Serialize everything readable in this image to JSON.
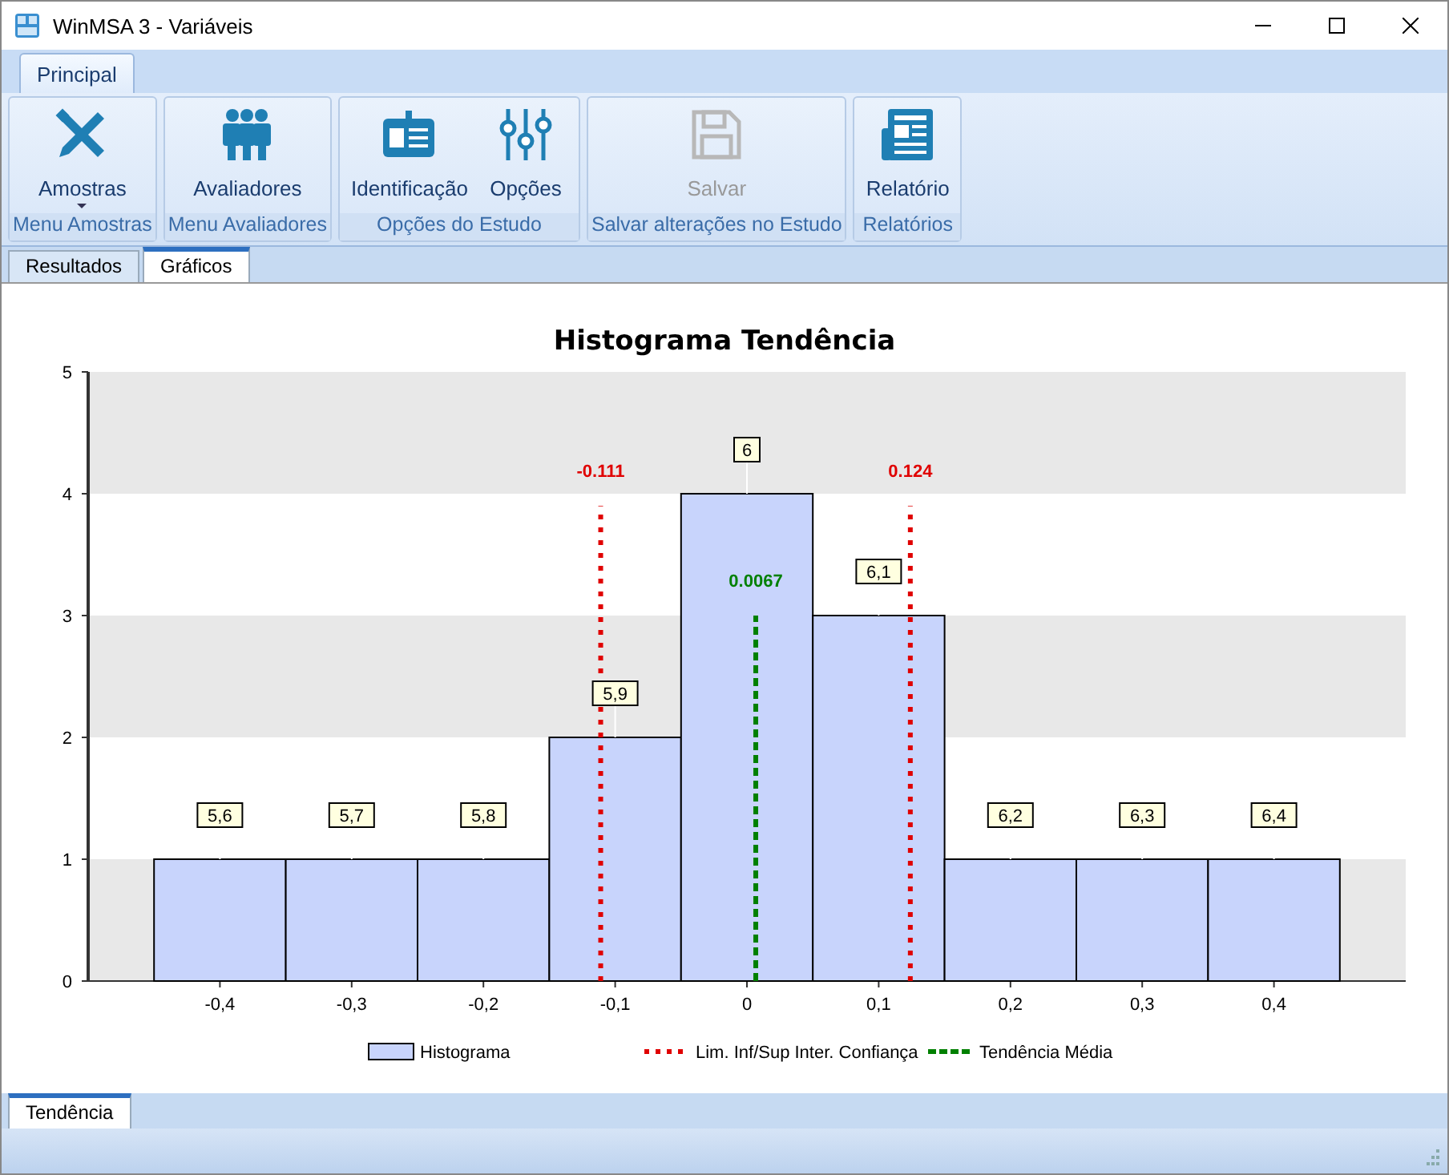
{
  "window": {
    "title": "WinMSA 3 - Variáveis"
  },
  "ribbon_tabs": [
    {
      "label": "Principal",
      "selected": true
    }
  ],
  "ribbon_groups": [
    {
      "caption": "Menu Amostras",
      "buttons": [
        {
          "label": "Amostras",
          "disabled": false,
          "dropdown": true
        }
      ]
    },
    {
      "caption": "Menu Avaliadores",
      "buttons": [
        {
          "label": "Avaliadores",
          "disabled": false,
          "dropdown": false
        }
      ]
    },
    {
      "caption": "Opções do Estudo",
      "buttons": [
        {
          "label": "Identificação",
          "disabled": false,
          "dropdown": false
        },
        {
          "label": "Opções",
          "disabled": false,
          "dropdown": false
        }
      ]
    },
    {
      "caption": "Salvar alterações no Estudo",
      "buttons": [
        {
          "label": "Salvar",
          "disabled": true,
          "dropdown": false
        }
      ]
    },
    {
      "caption": "Relatórios",
      "buttons": [
        {
          "label": "Relatório",
          "disabled": false,
          "dropdown": false
        }
      ]
    }
  ],
  "view_tabs": [
    {
      "label": "Resultados",
      "selected": false
    },
    {
      "label": "Gráficos",
      "selected": true
    }
  ],
  "chart": {
    "chart_data": {
      "type": "bar",
      "title": "Histograma Tendência",
      "x": [
        -0.4,
        -0.3,
        -0.2,
        -0.1,
        0,
        0.1,
        0.2,
        0.3,
        0.4
      ],
      "xlim": [
        -0.5,
        0.5
      ],
      "ylim": [
        0,
        5
      ],
      "yticks": [
        0,
        1,
        2,
        3,
        4,
        5
      ],
      "xticks": [
        {
          "value": -0.4,
          "label": "-0,4"
        },
        {
          "value": -0.3,
          "label": "-0,3"
        },
        {
          "value": -0.2,
          "label": "-0,2"
        },
        {
          "value": -0.1,
          "label": "-0,1"
        },
        {
          "value": 0,
          "label": "0"
        },
        {
          "value": 0.1,
          "label": "0,1"
        },
        {
          "value": 0.2,
          "label": "0,2"
        },
        {
          "value": 0.3,
          "label": "0,3"
        },
        {
          "value": 0.4,
          "label": "0,4"
        }
      ],
      "series": [
        {
          "name": "Histograma",
          "color": "#c8d4fc",
          "values": [
            1,
            1,
            1,
            2,
            4,
            3,
            1,
            1,
            1
          ]
        }
      ],
      "value_labels": [
        "5,6",
        "5,7",
        "5,8",
        "5,9",
        "6",
        "6,1",
        "6,2",
        "6,3",
        "6,4"
      ],
      "ref_lines": [
        {
          "axis": "x",
          "value": -0.111,
          "label": "-0.111",
          "color": "#e00000"
        },
        {
          "axis": "x",
          "value": 0.124,
          "label": "0.124",
          "color": "#e00000"
        },
        {
          "axis": "x",
          "value": 0.0067,
          "label": "0.0067",
          "color": "#008000"
        }
      ]
    },
    "legend": [
      {
        "kind": "dotted",
        "label": "Lim. Inf/Sup Inter. Confiança",
        "color": "#e00000"
      },
      {
        "kind": "dashed",
        "label": "Tendência Média",
        "color": "#008000"
      }
    ]
  },
  "bottom_tabs": [
    {
      "label": "Tendência",
      "selected": true
    }
  ]
}
